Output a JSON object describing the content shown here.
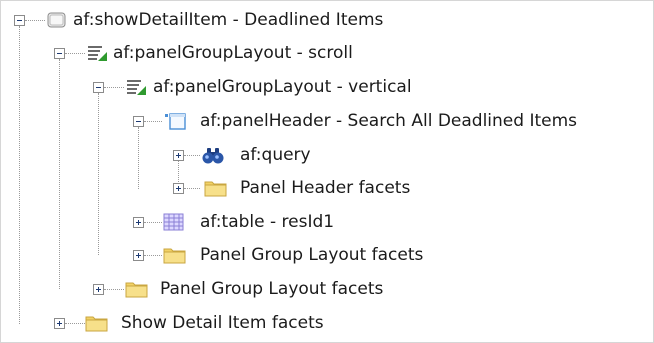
{
  "tree": {
    "nodes": [
      {
        "label": "af:showDetailItem - Deadlined Items",
        "icon": "show-detail-item-icon",
        "expanded": true
      },
      {
        "label": "af:panelGroupLayout - scroll",
        "icon": "panel-group-layout-icon",
        "expanded": true
      },
      {
        "label": "af:panelGroupLayout - vertical",
        "icon": "panel-group-layout-icon",
        "expanded": true
      },
      {
        "label": "af:panelHeader - Search All Deadlined Items",
        "icon": "panel-header-icon",
        "expanded": true
      },
      {
        "label": "af:query",
        "icon": "binoculars-icon",
        "expanded": false
      },
      {
        "label": "Panel Header facets",
        "icon": "folder-icon",
        "expanded": false
      },
      {
        "label": "af:table - resId1",
        "icon": "table-icon",
        "expanded": false
      },
      {
        "label": "Panel Group Layout facets",
        "icon": "folder-icon",
        "expanded": false
      },
      {
        "label": "Panel Group Layout facets",
        "icon": "folder-icon",
        "expanded": false
      },
      {
        "label": "Show Detail Item facets",
        "icon": "folder-icon",
        "expanded": false
      }
    ]
  },
  "colors": {
    "folder": "#f2d266",
    "folder_edge": "#c9a640",
    "accent_green": "#2f9a2f",
    "table_purple": "#8a7fd6",
    "header_blue": "#4a8fd6",
    "binoculars": "#2a56a8"
  }
}
